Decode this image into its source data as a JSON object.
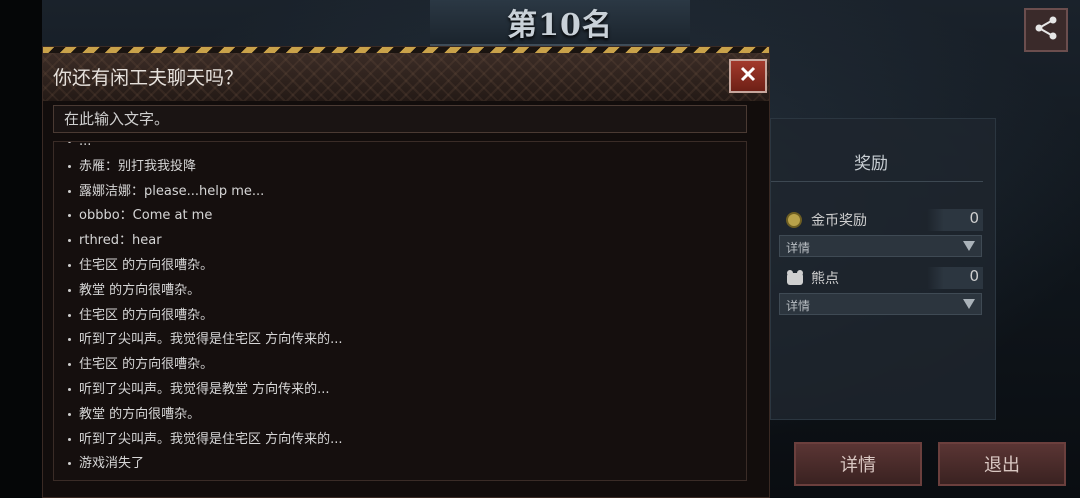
{
  "header": {
    "rank_title": "第10名"
  },
  "rewards": {
    "title": "奖励",
    "gold_label": "金币奖励",
    "gold_value": "0",
    "gold_details": "详情",
    "bear_label": "熊点",
    "bear_value": "0",
    "bear_details": "详情"
  },
  "buttons": {
    "details": "详情",
    "exit": "退出"
  },
  "chat": {
    "title": "你还有闲工夫聊天吗？",
    "input_placeholder": "在此输入文字。",
    "messages": [
      "...",
      "赤雁：别打我我投降",
      "露娜洁娜：please...help me...",
      "obbbo：Come at me",
      "rthred：hear",
      "住宅区 的方向很嘈杂。",
      "教堂 的方向很嘈杂。",
      "住宅区 的方向很嘈杂。",
      "听到了尖叫声。我觉得是住宅区 方向传来的...",
      "住宅区 的方向很嘈杂。",
      "听到了尖叫声。我觉得是教堂 方向传来的...",
      "教堂 的方向很嘈杂。",
      "听到了尖叫声。我觉得是住宅区 方向传来的...",
      "游戏消失了"
    ]
  },
  "icons": {
    "share": "share-icon",
    "close": "close-icon",
    "gold": "gold-coin-icon",
    "bear": "bear-point-icon"
  },
  "colors": {
    "accent_red": "#a33a2c",
    "hazard_yellow": "#c9a24a"
  }
}
